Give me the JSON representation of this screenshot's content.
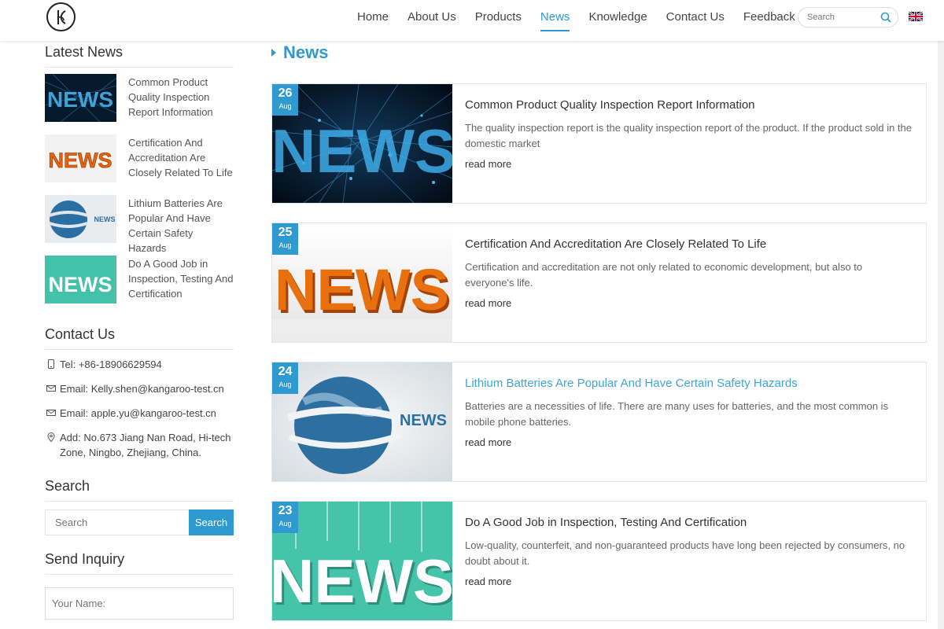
{
  "header": {
    "nav": [
      "Home",
      "About Us",
      "Products",
      "News",
      "Knowledge",
      "Contact Us",
      "Feedback"
    ],
    "active_index": 3,
    "search_placeholder": "Search"
  },
  "sidebar": {
    "latest_heading": "Latest News",
    "latest": [
      {
        "title": "Common Product Quality Inspection Report Information",
        "thumb": "news-blue-icon"
      },
      {
        "title": "Certification And Accreditation Are Closely Related To Life",
        "thumb": "news-orange-icon"
      },
      {
        "title": "Lithium Batteries Are Popular And Have Certain Safety Hazards",
        "thumb": "news-globe-icon"
      },
      {
        "title": "Do A Good Job in Inspection, Testing And Certification",
        "thumb": "news-teal-icon"
      }
    ],
    "contact_heading": "Contact Us",
    "contact": [
      {
        "icon": "phone-icon",
        "text": "Tel: +86-18906629594"
      },
      {
        "icon": "mail-icon",
        "text": "Email: Kelly.shen@kangaroo-test.cn"
      },
      {
        "icon": "mail-icon",
        "text": "Email: apple.yu@kangaroo-test.cn"
      },
      {
        "icon": "location-icon",
        "text": "Add: No.673 Jiang Nan Road, Hi-tech Zone, Ningbo, Zhejiang, China."
      }
    ],
    "search_heading": "Search",
    "search_placeholder": "Search",
    "search_button": "Search",
    "inquiry_heading": "Send Inquiry",
    "inquiry_name_placeholder": "Your Name:"
  },
  "main": {
    "title": "News",
    "read_more": "read more",
    "articles": [
      {
        "day": "26",
        "month": "Aug",
        "title": "Common Product Quality Inspection Report Information",
        "desc": "The quality inspection report is the quality inspection report of the product. If the product sold in the domestic market"
      },
      {
        "day": "25",
        "month": "Aug",
        "title": "Certification And Accreditation Are Closely Related To Life",
        "desc": "Certification and accreditation are not only related to economic development, but also to everyone's life."
      },
      {
        "day": "24",
        "month": "Aug",
        "title": "Lithium Batteries Are Popular And Have Certain Safety Hazards",
        "desc": "Batteries are a necessities of life. There are many uses for batteries, and the most common is mobile phone batteries."
      },
      {
        "day": "23",
        "month": "Aug",
        "title": "Do A Good Job in Inspection, Testing And Certification",
        "desc": "Low-quality, counterfeit, and non-guaranteed products have long been rejected by consumers, no doubt about it."
      }
    ]
  },
  "images": {
    "img2_text": "NEWS",
    "img3_text": "NEWS"
  },
  "colors": {
    "accent": "#2f9ad0",
    "highlight": "#3fa5d7"
  }
}
